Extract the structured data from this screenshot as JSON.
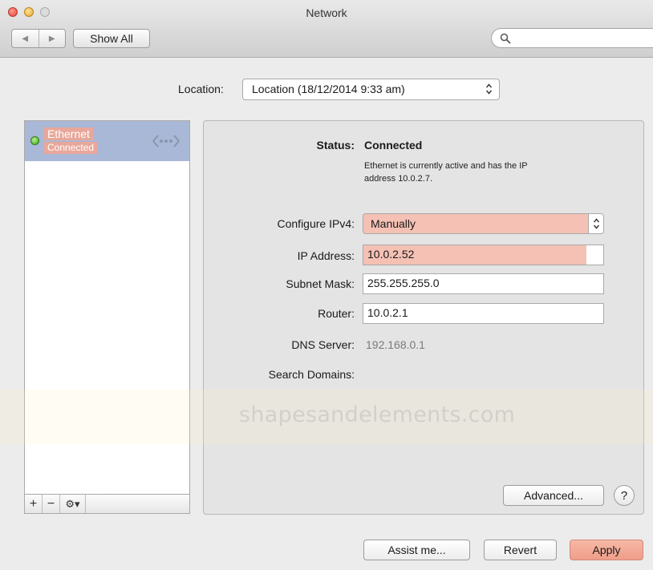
{
  "window": {
    "title": "Network",
    "traffic_lights": [
      "close",
      "minimize",
      "zoom"
    ]
  },
  "toolbar": {
    "back_icon": "back-arrow-icon",
    "forward_icon": "forward-arrow-icon",
    "show_all_label": "Show All",
    "search_icon": "search-icon",
    "search_value": ""
  },
  "location": {
    "label": "Location:",
    "selected": "Location (18/12/2014 9:33 am)"
  },
  "sidebar": {
    "services": [
      {
        "name": "Ethernet",
        "status": "Connected",
        "status_color": "#3fa41f",
        "icon": "ethernet-icon"
      }
    ],
    "buttons": {
      "add": "+",
      "remove": "−",
      "gear": "⚙▾"
    }
  },
  "detail": {
    "status_label": "Status:",
    "status_value": "Connected",
    "status_desc_line1": "Ethernet is currently active and has the IP",
    "status_desc_line2": "address 10.0.2.7.",
    "configure_label": "Configure IPv4:",
    "configure_value": "Manually",
    "ip_label": "IP Address:",
    "ip_value": "10.0.2.52",
    "subnet_label": "Subnet Mask:",
    "subnet_value": "255.255.255.0",
    "router_label": "Router:",
    "router_value": "10.0.2.1",
    "dns_label": "DNS Server:",
    "dns_value": "192.168.0.1",
    "search_domains_label": "Search Domains:",
    "watermark": "shapesandelements.com",
    "advanced_label": "Advanced...",
    "help_label": "?"
  },
  "footer": {
    "assist_label": "Assist me...",
    "revert_label": "Revert",
    "apply_label": "Apply"
  },
  "colors": {
    "highlight": "#f4c1b4",
    "selection": "#a9b8d6",
    "apply": "#ef9e89"
  }
}
